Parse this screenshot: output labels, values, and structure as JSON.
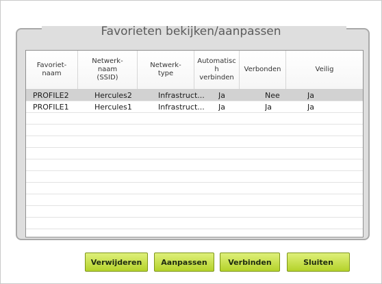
{
  "dialog": {
    "title": "Favorieten bekijken/aanpassen"
  },
  "table": {
    "columns": [
      "Favoriet-\nnaam",
      "Netwerk-\nnaam\n(SSID)",
      "Netwerk-\ntype",
      "Automatisc\nh\nverbinden",
      "Verbonden",
      "Veilig"
    ],
    "rows": [
      [
        "PROFILE2",
        "Hercules2",
        "Infrastruct...",
        "Ja",
        "Nee",
        "Ja"
      ],
      [
        "PROFILE1",
        "Hercules1",
        "Infrastruct...",
        "Ja",
        "Ja",
        "Ja"
      ]
    ],
    "selected_row": 0
  },
  "buttons": {
    "delete": "Verwijderen",
    "edit": "Aanpassen",
    "connect": "Verbinden",
    "close": "Sluiten"
  },
  "colors": {
    "button_top": "#dff07a",
    "button_bottom": "#b4d22a",
    "selection": "#d2d2d2"
  }
}
